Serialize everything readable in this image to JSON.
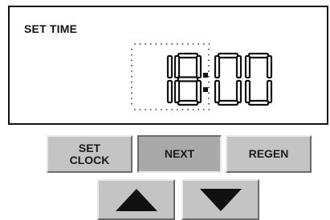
{
  "display": {
    "mode_label": "SET TIME",
    "time": "18:00"
  },
  "buttons": {
    "set_clock_line1": "SET",
    "set_clock_line2": "CLOCK",
    "next": "NEXT",
    "regen": "REGEN",
    "up_icon": "triangle-up",
    "down_icon": "triangle-down"
  },
  "state": {
    "pressed_button": "next",
    "blinking_field": "hours"
  },
  "colors": {
    "button_face": "#c4c4c4",
    "button_pressed": "#a9a9a9",
    "segment": "#111111"
  }
}
